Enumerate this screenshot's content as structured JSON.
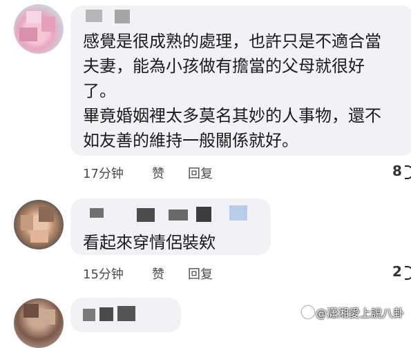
{
  "comments": [
    {
      "lines": [
        "感覺是很成熟的處理，也許只是不適合當",
        "夫妻，能為小孩做有擔當的父母就很好",
        "了。",
        "畢竟婚姻裡太多莫名其妙的人事物，還不",
        "如友善的維持一般關係就好。"
      ],
      "time": "17分钟",
      "like_label": "赞",
      "reply_label": "回复",
      "reply_count": "8"
    },
    {
      "lines": [
        "看起來穿情侶裝欸"
      ],
      "time": "15分钟",
      "like_label": "赞",
      "reply_label": "回复",
      "reply_count": "2"
    }
  ],
  "watermark": "@瀟湘愛上說八卦"
}
